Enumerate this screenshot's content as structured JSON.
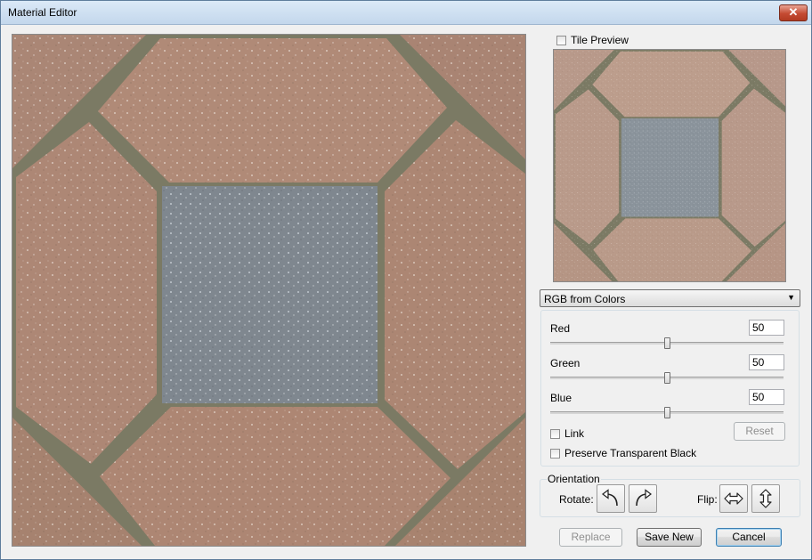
{
  "window": {
    "title": "Material Editor",
    "close_label": "✕"
  },
  "preview": {
    "tile_preview_label": "Tile Preview",
    "tile_preview_checked": false
  },
  "mode": {
    "selected": "RGB from Colors"
  },
  "channels": [
    {
      "label": "Red",
      "value": "50",
      "fraction": 0.5
    },
    {
      "label": "Green",
      "value": "50",
      "fraction": 0.5
    },
    {
      "label": "Blue",
      "value": "50",
      "fraction": 0.5
    }
  ],
  "options": {
    "link_label": "Link",
    "link_checked": false,
    "preserve_label": "Preserve Transparent Black",
    "preserve_checked": false,
    "reset_label": "Reset"
  },
  "orientation": {
    "group_label": "Orientation",
    "rotate_label": "Rotate:",
    "flip_label": "Flip:",
    "icons": [
      "rotate-left-icon",
      "rotate-right-icon",
      "flip-horizontal-icon",
      "flip-vertical-icon"
    ]
  },
  "footer": {
    "replace_label": "Replace",
    "save_new_label": "Save New",
    "cancel_label": "Cancel"
  },
  "colors": {
    "brick": "#ad8572",
    "stone": "#7d858d",
    "grout": "#7b7a64",
    "accent_border": "#3c7fb1"
  }
}
